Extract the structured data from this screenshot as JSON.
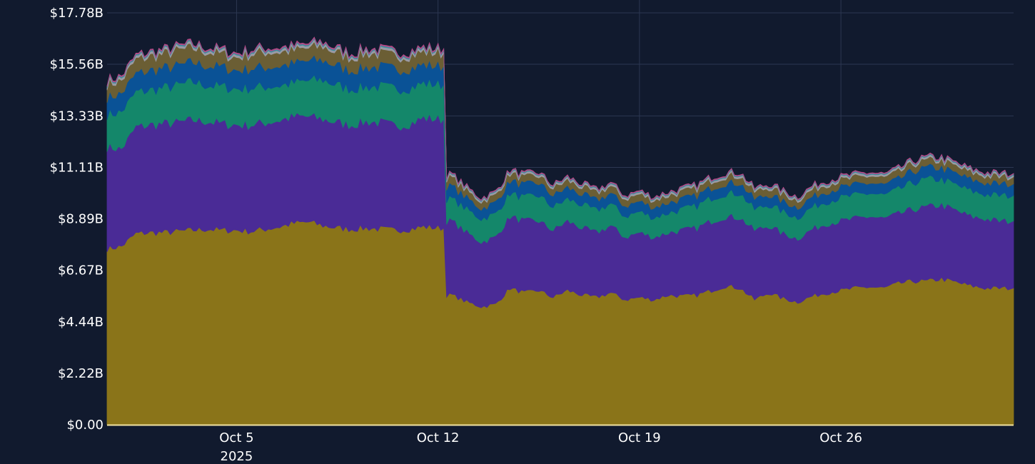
{
  "chart_data": {
    "type": "area",
    "stacked": true,
    "title": "",
    "xlabel": "",
    "ylabel": "",
    "y_tick_labels": [
      "$0.00",
      "$2.22B",
      "$4.44B",
      "$6.67B",
      "$8.89B",
      "$11.11B",
      "$13.33B",
      "$15.56B",
      "$17.78B"
    ],
    "y_tick_values": [
      0,
      2.22,
      4.44,
      6.67,
      8.89,
      11.11,
      13.33,
      15.56,
      17.78
    ],
    "ylim": [
      0,
      17.78
    ],
    "y_unit": "billions USD",
    "x_tick_labels": [
      "Oct 5",
      "Oct 12",
      "Oct 19",
      "Oct 26"
    ],
    "x_tick_positions": [
      "2025-10-05",
      "2025-10-12",
      "2025-10-19",
      "2025-10-26"
    ],
    "x_year_label": "2025",
    "x_start": "2025-09-30 12:00",
    "x_end": "2025-11-01 00:00",
    "x": [
      "2025-09-30 12:00",
      "2025-10-01 00:00",
      "2025-10-01 12:00",
      "2025-10-02 00:00",
      "2025-10-02 12:00",
      "2025-10-03 00:00",
      "2025-10-03 12:00",
      "2025-10-04 00:00",
      "2025-10-04 12:00",
      "2025-10-05 00:00",
      "2025-10-05 12:00",
      "2025-10-06 00:00",
      "2025-10-06 12:00",
      "2025-10-07 00:00",
      "2025-10-07 12:00",
      "2025-10-08 00:00",
      "2025-10-08 12:00",
      "2025-10-09 00:00",
      "2025-10-09 12:00",
      "2025-10-10 00:00",
      "2025-10-10 12:00",
      "2025-10-11 00:00",
      "2025-10-11 12:00",
      "2025-10-12 00:00",
      "2025-10-12 12:00",
      "2025-10-13 00:00",
      "2025-10-13 12:00",
      "2025-10-14 00:00",
      "2025-10-14 12:00",
      "2025-10-15 00:00",
      "2025-10-15 12:00",
      "2025-10-16 00:00",
      "2025-10-16 12:00",
      "2025-10-17 00:00",
      "2025-10-17 12:00",
      "2025-10-18 00:00",
      "2025-10-18 12:00",
      "2025-10-19 00:00",
      "2025-10-19 12:00",
      "2025-10-20 00:00",
      "2025-10-20 12:00",
      "2025-10-21 00:00",
      "2025-10-21 12:00",
      "2025-10-22 00:00",
      "2025-10-22 12:00",
      "2025-10-23 00:00",
      "2025-10-23 12:00",
      "2025-10-24 00:00",
      "2025-10-24 12:00",
      "2025-10-25 00:00",
      "2025-10-25 12:00",
      "2025-10-26 00:00",
      "2025-10-26 12:00",
      "2025-10-27 00:00",
      "2025-10-27 12:00",
      "2025-10-28 00:00",
      "2025-10-28 12:00",
      "2025-10-29 00:00",
      "2025-10-29 12:00",
      "2025-10-30 00:00",
      "2025-10-30 12:00",
      "2025-10-31 00:00",
      "2025-10-31 12:00",
      "2025-11-01 00:00"
    ],
    "series": [
      {
        "color": "#8a7419",
        "values": [
          7.6,
          7.7,
          8.25,
          8.3,
          8.3,
          8.35,
          8.4,
          8.45,
          8.4,
          8.4,
          8.35,
          8.45,
          8.55,
          8.7,
          8.75,
          8.6,
          8.5,
          8.45,
          8.5,
          8.45,
          8.4,
          8.45,
          8.55,
          8.5,
          5.6,
          5.3,
          5.1,
          5.2,
          5.9,
          5.7,
          5.8,
          5.5,
          5.8,
          5.6,
          5.5,
          5.7,
          5.4,
          5.5,
          5.4,
          5.6,
          5.55,
          5.6,
          5.8,
          6.0,
          5.9,
          5.4,
          5.7,
          5.45,
          5.3,
          5.55,
          5.7,
          5.8,
          5.9,
          5.95,
          5.9,
          6.1,
          6.2,
          6.2,
          6.3,
          6.15,
          6.0,
          5.9,
          5.9,
          5.9
        ]
      },
      {
        "color": "#4a2b96",
        "values": [
          4.4,
          4.2,
          4.6,
          4.65,
          4.7,
          4.7,
          4.75,
          4.65,
          4.6,
          4.55,
          4.6,
          4.6,
          4.6,
          4.6,
          4.55,
          4.6,
          4.55,
          4.5,
          4.6,
          4.6,
          4.5,
          4.55,
          4.7,
          4.7,
          3.2,
          3.0,
          2.8,
          2.9,
          3.1,
          3.1,
          3.0,
          2.9,
          3.0,
          2.9,
          2.8,
          2.9,
          2.7,
          2.8,
          2.7,
          2.7,
          2.85,
          2.9,
          3.0,
          3.0,
          3.05,
          3.0,
          2.9,
          2.8,
          2.75,
          2.9,
          3.0,
          3.0,
          3.0,
          3.05,
          3.0,
          3.0,
          3.1,
          3.2,
          3.2,
          3.1,
          3.0,
          3.0,
          2.9,
          2.9
        ]
      },
      {
        "color": "#14876a",
        "values": [
          1.4,
          1.6,
          1.5,
          1.5,
          1.55,
          1.6,
          1.65,
          1.55,
          1.6,
          1.55,
          1.6,
          1.55,
          1.5,
          1.45,
          1.55,
          1.7,
          1.6,
          1.55,
          1.5,
          1.55,
          1.6,
          1.55,
          1.5,
          1.5,
          0.95,
          1.0,
          1.0,
          1.0,
          1.0,
          1.0,
          1.1,
          1.0,
          0.95,
          1.0,
          0.95,
          0.95,
          0.9,
          0.9,
          0.85,
          0.85,
          0.9,
          0.95,
          1.0,
          1.0,
          1.05,
          0.9,
          0.9,
          0.95,
          0.9,
          0.95,
          0.95,
          1.0,
          1.0,
          1.0,
          1.0,
          1.05,
          1.15,
          1.2,
          1.1,
          1.1,
          1.1,
          1.05,
          1.1,
          1.1
        ]
      },
      {
        "color": "#0a5296",
        "values": [
          0.75,
          0.8,
          0.8,
          0.85,
          0.85,
          0.85,
          0.85,
          0.85,
          0.85,
          0.8,
          0.85,
          0.85,
          0.85,
          0.85,
          0.85,
          0.85,
          0.85,
          0.8,
          0.85,
          0.85,
          0.85,
          0.85,
          0.8,
          0.8,
          0.55,
          0.5,
          0.45,
          0.5,
          0.55,
          0.55,
          0.55,
          0.5,
          0.5,
          0.45,
          0.45,
          0.45,
          0.45,
          0.45,
          0.45,
          0.45,
          0.45,
          0.45,
          0.45,
          0.45,
          0.45,
          0.45,
          0.45,
          0.45,
          0.45,
          0.45,
          0.45,
          0.45,
          0.45,
          0.45,
          0.45,
          0.45,
          0.5,
          0.5,
          0.5,
          0.5,
          0.5,
          0.5,
          0.5,
          0.5
        ]
      },
      {
        "color": "#6b5e34",
        "values": [
          0.55,
          0.55,
          0.6,
          0.6,
          0.6,
          0.65,
          0.6,
          0.6,
          0.55,
          0.55,
          0.6,
          0.65,
          0.6,
          0.55,
          0.55,
          0.6,
          0.55,
          0.55,
          0.6,
          0.55,
          0.55,
          0.55,
          0.55,
          0.55,
          0.35,
          0.3,
          0.3,
          0.3,
          0.3,
          0.3,
          0.3,
          0.3,
          0.3,
          0.3,
          0.3,
          0.3,
          0.3,
          0.3,
          0.3,
          0.3,
          0.3,
          0.3,
          0.3,
          0.3,
          0.3,
          0.3,
          0.3,
          0.3,
          0.3,
          0.3,
          0.3,
          0.3,
          0.3,
          0.3,
          0.3,
          0.3,
          0.3,
          0.3,
          0.3,
          0.3,
          0.3,
          0.3,
          0.3,
          0.3
        ]
      },
      {
        "color": "#9a9aa4",
        "values": [
          0.1,
          0.1,
          0.1,
          0.1,
          0.1,
          0.1,
          0.1,
          0.1,
          0.1,
          0.1,
          0.1,
          0.1,
          0.1,
          0.1,
          0.1,
          0.1,
          0.1,
          0.1,
          0.1,
          0.1,
          0.1,
          0.1,
          0.1,
          0.1,
          0.08,
          0.08,
          0.08,
          0.08,
          0.08,
          0.08,
          0.08,
          0.08,
          0.08,
          0.08,
          0.08,
          0.08,
          0.08,
          0.08,
          0.08,
          0.08,
          0.08,
          0.08,
          0.08,
          0.08,
          0.08,
          0.08,
          0.08,
          0.08,
          0.08,
          0.08,
          0.08,
          0.08,
          0.08,
          0.08,
          0.08,
          0.08,
          0.08,
          0.08,
          0.08,
          0.08,
          0.08,
          0.08,
          0.08,
          0.08
        ]
      },
      {
        "color": "#3a8fa0",
        "values": [
          0.05,
          0.05,
          0.05,
          0.05,
          0.05,
          0.05,
          0.05,
          0.05,
          0.05,
          0.05,
          0.05,
          0.05,
          0.05,
          0.05,
          0.05,
          0.05,
          0.05,
          0.05,
          0.05,
          0.05,
          0.05,
          0.05,
          0.05,
          0.05,
          0.04,
          0.04,
          0.04,
          0.04,
          0.04,
          0.04,
          0.04,
          0.04,
          0.04,
          0.04,
          0.04,
          0.04,
          0.04,
          0.04,
          0.04,
          0.04,
          0.04,
          0.04,
          0.04,
          0.04,
          0.04,
          0.04,
          0.04,
          0.04,
          0.04,
          0.04,
          0.04,
          0.04,
          0.04,
          0.04,
          0.04,
          0.04,
          0.04,
          0.04,
          0.04,
          0.04,
          0.04,
          0.04,
          0.04,
          0.04
        ]
      },
      {
        "color": "#b04a86",
        "values": [
          0.04,
          0.04,
          0.04,
          0.04,
          0.04,
          0.04,
          0.04,
          0.04,
          0.04,
          0.04,
          0.04,
          0.04,
          0.04,
          0.04,
          0.04,
          0.04,
          0.04,
          0.04,
          0.04,
          0.04,
          0.04,
          0.04,
          0.04,
          0.04,
          0.03,
          0.03,
          0.03,
          0.03,
          0.03,
          0.03,
          0.03,
          0.03,
          0.03,
          0.03,
          0.03,
          0.03,
          0.03,
          0.03,
          0.03,
          0.03,
          0.03,
          0.03,
          0.03,
          0.03,
          0.03,
          0.03,
          0.03,
          0.03,
          0.03,
          0.03,
          0.03,
          0.03,
          0.03,
          0.03,
          0.03,
          0.03,
          0.03,
          0.03,
          0.03,
          0.03,
          0.03,
          0.03,
          0.03,
          0.03
        ]
      }
    ],
    "grid": true,
    "legend": "none",
    "colors": {
      "background": "#111a2e",
      "grid": "#2c3752",
      "text": "#ffffff",
      "baseline": "#f2e3a0"
    }
  }
}
